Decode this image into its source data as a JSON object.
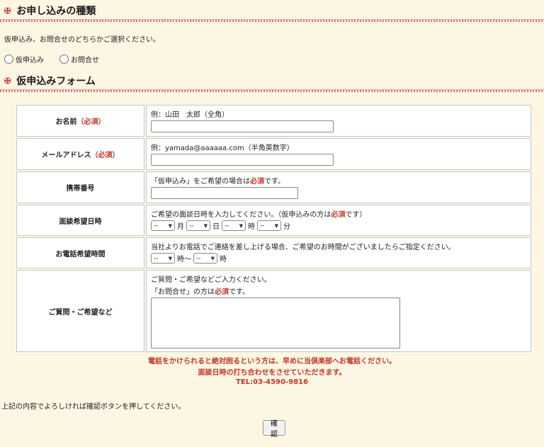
{
  "section1": {
    "mark": "✠",
    "title": "お申し込みの種類"
  },
  "section1_desc": "仮申込み、お問合せのどちらかご選択ください。",
  "radios": [
    {
      "label": "仮申込み"
    },
    {
      "label": "お問合せ"
    }
  ],
  "section2": {
    "mark": "✠",
    "title": "仮申込みフォーム"
  },
  "form": {
    "name": {
      "label": "お名前",
      "req": "（必須）",
      "hint": "例：山田　太郎（全角）",
      "value": ""
    },
    "email": {
      "label": "メールアドレス",
      "req": "（必須）",
      "hint": "例：yamada@aaaaaa.com（半角英数字）",
      "value": ""
    },
    "mobile": {
      "label": "携帯番号",
      "hint_pre": "「仮申込み」をご希望の場合は",
      "hint_req": "必須",
      "hint_post": "です。",
      "value": ""
    },
    "interview": {
      "label": "面談希望日時",
      "hint_pre": "ご希望の面談日時を入力してください。（仮申込みの方は",
      "hint_req": "必須",
      "hint_post": "です）",
      "selects": [
        {
          "value": "--",
          "unit": "月"
        },
        {
          "value": "--",
          "unit": "日"
        },
        {
          "value": "--",
          "unit": "時"
        },
        {
          "value": "--",
          "unit": "分"
        }
      ]
    },
    "phone_time": {
      "label": "お電話希望時間",
      "hint": "当社よりお電話でご連絡を差し上げる場合、ご希望のお時間がございましたらご指定ください。",
      "selects": [
        {
          "value": "--",
          "unit": "時〜"
        },
        {
          "value": "--",
          "unit": "時"
        }
      ]
    },
    "questions": {
      "label": "ご質問・ご希望など",
      "hint1": "ご質問・ご希望などご入力ください。",
      "hint2_pre": "「お問合せ」の方は",
      "hint2_req": "必須",
      "hint2_post": "です。",
      "value": ""
    }
  },
  "notice": {
    "line1": "電話をかけられると絶対困るという方は、早めに当倶楽部へお電話ください。",
    "line2": "面談日時の打ち合わせをさせていただきます。",
    "line3": "TEL:03-4590-9816"
  },
  "footer_text": "上記の内容でよろしければ確認ボタンを押してください。",
  "confirm_button": "確認",
  "colors": {
    "accent": "#c0392b",
    "background": "#fdf6e3"
  }
}
